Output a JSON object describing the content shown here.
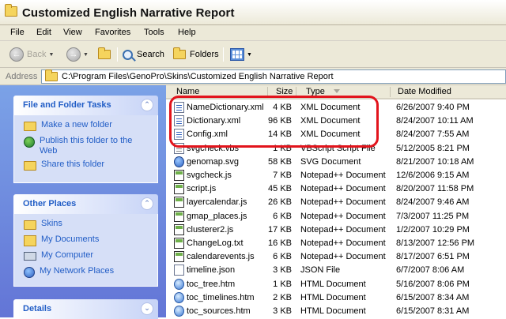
{
  "window": {
    "title": "Customized English Narrative Report"
  },
  "menu": [
    {
      "label": "File"
    },
    {
      "label": "Edit"
    },
    {
      "label": "View"
    },
    {
      "label": "Favorites"
    },
    {
      "label": "Tools"
    },
    {
      "label": "Help"
    }
  ],
  "toolbar": {
    "back_label": "Back",
    "search_label": "Search",
    "folders_label": "Folders"
  },
  "address": {
    "label": "Address",
    "path": "C:\\Program Files\\GenoPro\\Skins\\Customized English Narrative Report"
  },
  "tasks_panel": {
    "title": "File and Folder Tasks",
    "items": [
      {
        "label": "Make a new folder",
        "icon": "new-folder-icon"
      },
      {
        "label": "Publish this folder to the Web",
        "icon": "publish-web-icon"
      },
      {
        "label": "Share this folder",
        "icon": "share-folder-icon"
      }
    ]
  },
  "places_panel": {
    "title": "Other Places",
    "items": [
      {
        "label": "Skins",
        "icon": "folder-icon"
      },
      {
        "label": "My Documents",
        "icon": "my-documents-icon"
      },
      {
        "label": "My Computer",
        "icon": "my-computer-icon"
      },
      {
        "label": "My Network Places",
        "icon": "network-places-icon"
      }
    ]
  },
  "details_panel": {
    "title": "Details"
  },
  "columns": {
    "name": "Name",
    "size": "Size",
    "type": "Type",
    "date": "Date Modified"
  },
  "files": [
    {
      "name": "NameDictionary.xml",
      "size": "4 KB",
      "type": "XML Document",
      "date": "6/26/2007 9:40 PM",
      "icon": "xml"
    },
    {
      "name": "Dictionary.xml",
      "size": "96 KB",
      "type": "XML Document",
      "date": "8/24/2007 10:11 AM",
      "icon": "xml"
    },
    {
      "name": "Config.xml",
      "size": "14 KB",
      "type": "XML Document",
      "date": "8/24/2007 7:55 AM",
      "icon": "xml"
    },
    {
      "name": "svgcheck.vbs",
      "size": "1 KB",
      "type": "VBScript Script File",
      "date": "5/12/2005 8:21 PM",
      "icon": "txt"
    },
    {
      "name": "genomap.svg",
      "size": "58 KB",
      "type": "SVG Document",
      "date": "8/21/2007 10:18 AM",
      "icon": "svg"
    },
    {
      "name": "svgcheck.js",
      "size": "7 KB",
      "type": "Notepad++ Document",
      "date": "12/6/2006 9:15 AM",
      "icon": "np"
    },
    {
      "name": "script.js",
      "size": "45 KB",
      "type": "Notepad++ Document",
      "date": "8/20/2007 11:58 PM",
      "icon": "np"
    },
    {
      "name": "layercalendar.js",
      "size": "26 KB",
      "type": "Notepad++ Document",
      "date": "8/24/2007 9:46 AM",
      "icon": "np"
    },
    {
      "name": "gmap_places.js",
      "size": "6 KB",
      "type": "Notepad++ Document",
      "date": "7/3/2007 11:25 PM",
      "icon": "np"
    },
    {
      "name": "clusterer2.js",
      "size": "17 KB",
      "type": "Notepad++ Document",
      "date": "1/2/2007 10:29 PM",
      "icon": "np"
    },
    {
      "name": "ChangeLog.txt",
      "size": "16 KB",
      "type": "Notepad++ Document",
      "date": "8/13/2007 12:56 PM",
      "icon": "np"
    },
    {
      "name": "calendarevents.js",
      "size": "6 KB",
      "type": "Notepad++ Document",
      "date": "8/17/2007 6:51 PM",
      "icon": "np"
    },
    {
      "name": "timeline.json",
      "size": "3 KB",
      "type": "JSON File",
      "date": "6/7/2007 8:06 AM",
      "icon": "json"
    },
    {
      "name": "toc_tree.htm",
      "size": "1 KB",
      "type": "HTML Document",
      "date": "5/16/2007 8:06 PM",
      "icon": "html"
    },
    {
      "name": "toc_timelines.htm",
      "size": "2 KB",
      "type": "HTML Document",
      "date": "6/15/2007 8:34 AM",
      "icon": "html"
    },
    {
      "name": "toc_sources.htm",
      "size": "3 KB",
      "type": "HTML Document",
      "date": "6/15/2007 8:31 AM",
      "icon": "html"
    }
  ],
  "highlight_color": "#e2141c"
}
